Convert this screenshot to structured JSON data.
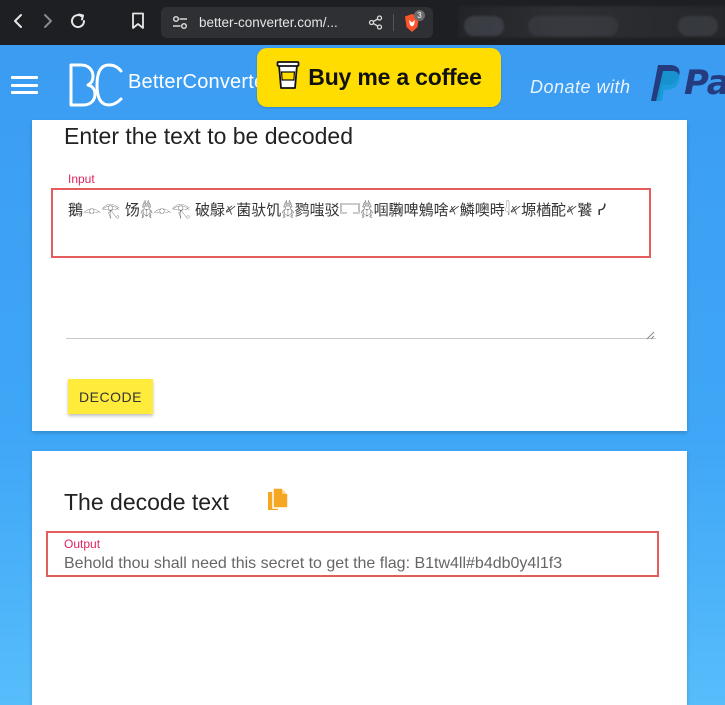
{
  "browser": {
    "url": "better-converter.com/...",
    "shield_badge": "3"
  },
  "header": {
    "brand": "BetterConverter",
    "coffee_label": "Buy me a coffee",
    "donate_label": "Donate with",
    "paypal_text": "Pa"
  },
  "decoder": {
    "title": "Enter the text to be decoded",
    "input_label": "Input",
    "input_value": "鵝𓁹𓂀 饧𓆣𓁹𓂀 破鵦𐤀菌驮饥𓆣鹨嗤驳𓉐𓆣啯驧啤鵵啥𐤀鱗噢時𓇋𐤀塬楢酡𐤀饕 ᓯ",
    "decode_button": "DECODE"
  },
  "output": {
    "title": "The decode text",
    "output_label": "Output",
    "output_value": "Behold thou shall need this secret to get the flag: B1tw4ll#b4db0y4l1f3"
  },
  "colors": {
    "header_blue": "#3b9cf2",
    "coffee_yellow": "#ffdd00",
    "decode_yellow": "#ffeb3b",
    "label_pink": "#e0245e",
    "copy_orange": "#f5a623",
    "highlight_red": "#e45c5c"
  }
}
